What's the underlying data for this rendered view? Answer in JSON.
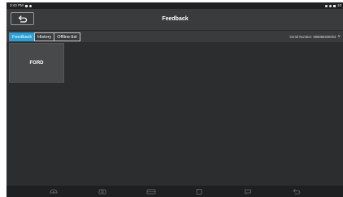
{
  "status_bar": {
    "time": "3:43 PM",
    "right_text": "10"
  },
  "header": {
    "title": "Feedback",
    "back_icon": "back-arrow-icon"
  },
  "tabs": [
    {
      "label": "Feedback",
      "active": true
    },
    {
      "label": "History",
      "active": false
    },
    {
      "label": "Offline-list",
      "active": false
    }
  ],
  "serial": {
    "label": "Serial Number: 988888400003"
  },
  "vehicles": [
    {
      "label": "FORD"
    }
  ],
  "nav": {
    "icons": [
      "diagnose-icon",
      "camera-icon",
      "vehicle-icon",
      "copy-icon",
      "message-icon",
      "return-icon"
    ]
  },
  "colors": {
    "accent": "#2a9fd6",
    "background": "#2c2d2f",
    "bar": "#3a3b3d"
  }
}
